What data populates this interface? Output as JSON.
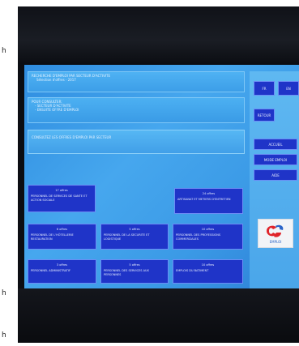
{
  "side_labels": [
    "h",
    "h",
    "h"
  ],
  "screen": {
    "banner1": {
      "line1": "RECHERCHE D'EMPLOI PAR SECTEUR D'ACTIVITE",
      "line2": "Sélection d'offres - 2017"
    },
    "banner2": {
      "line1": "POUR CONSULTER:",
      "line2": "- SECTEUR D'ACTIVITE",
      "line3": "- ENSUITE OFFRE D'EMPLOI"
    },
    "banner3": {
      "line1": "CONSULTEZ LES OFFRES D'EMPLOI PAR SECTEUR"
    },
    "right_panel": {
      "top_left": "FR",
      "top_right": "EN",
      "retour": "RETOUR",
      "accueil": "ACCUEIL",
      "mode_emploi": "MODE EMPLOI",
      "aide": "AIDE",
      "logo_text": "EMPLOI"
    },
    "tiles": [
      {
        "title": "17 offres",
        "label": "PERSONNEL DE SERVICES DE SANTE ET ACTION SOCIALE"
      },
      {
        "title": "24 offres",
        "label": "ARTISANAT ET METIERS D'ENTRETIEN"
      },
      {
        "title": "6 offres",
        "label": "PERSONNEL DE L'HÔTELLERIE RESTAURATION"
      },
      {
        "title": "5 offres",
        "label": "PERSONNEL DE LA SECURITE ET LOGISTIQUE"
      },
      {
        "title": "10 offres",
        "label": "PERSONNEL DES PROFESSIONS COMMERCIALES"
      },
      {
        "title": "3 offres",
        "label": "PERSONNEL ADMINISTRATIF"
      },
      {
        "title": "5 offres",
        "label": "PERSONNEL DES SERVICES AUX PERSONNES"
      },
      {
        "title": "10 offres",
        "label": "EMPLOIS DU BATIMENT"
      }
    ]
  }
}
